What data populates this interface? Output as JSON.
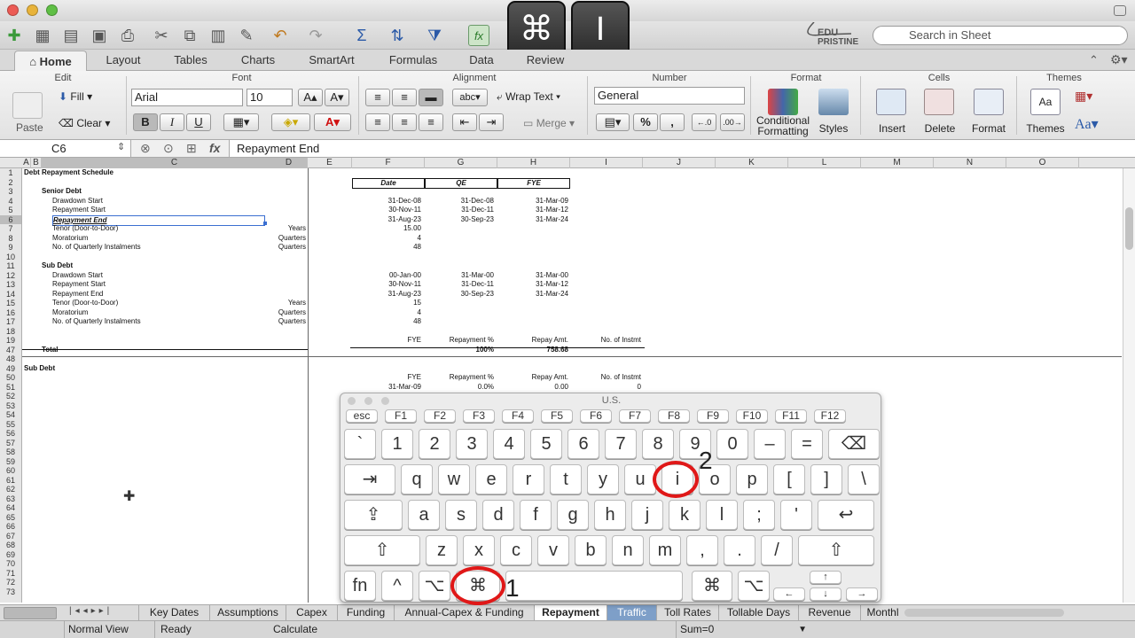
{
  "toolbar": {
    "search_placeholder": "Search in Sheet"
  },
  "ribbon_tabs": [
    "Home",
    "Layout",
    "Tables",
    "Charts",
    "SmartArt",
    "Formulas",
    "Data",
    "Review"
  ],
  "ribbon": {
    "groups": {
      "edit": "Edit",
      "font": "Font",
      "alignment": "Alignment",
      "number": "Number",
      "format": "Format",
      "cells": "Cells",
      "themes": "Themes"
    },
    "paste": "Paste",
    "fill": "Fill",
    "clear": "Clear",
    "font_name": "Arial",
    "font_size": "10",
    "wrap_text": "Wrap Text",
    "merge": "Merge",
    "abc": "abc",
    "number_format": "General",
    "conditional_formatting": "Conditional Formatting",
    "styles": "Styles",
    "insert": "Insert",
    "delete": "Delete",
    "format_btn": "Format",
    "themes_btn": "Themes",
    "bold": "B",
    "italic": "I",
    "underline": "U",
    "percent": "%",
    "comma": ","
  },
  "formula_bar": {
    "cell_ref": "C6",
    "content": "Repayment End",
    "fx": "fx"
  },
  "columns": [
    "A",
    "B",
    "C",
    "D",
    "E",
    "F",
    "G",
    "H",
    "I",
    "J",
    "K",
    "L",
    "M",
    "N",
    "O"
  ],
  "rows": [
    "1",
    "2",
    "3",
    "4",
    "5",
    "6",
    "7",
    "8",
    "9",
    "10",
    "11",
    "12",
    "13",
    "14",
    "15",
    "16",
    "17",
    "18",
    "19",
    "47",
    "48",
    "49",
    "50",
    "51",
    "52",
    "53",
    "54",
    "55",
    "56",
    "57",
    "58",
    "59",
    "60",
    "61",
    "62",
    "63",
    "64",
    "65",
    "66",
    "67",
    "68",
    "69",
    "70",
    "71",
    "72",
    "73"
  ],
  "sheet": {
    "title": "Debt Repayment Schedule",
    "hdr_date": "Date",
    "hdr_qe": "QE",
    "hdr_fye": "FYE",
    "senior_debt": "Senior Debt",
    "s_rows": [
      {
        "label": "Drawdown Start",
        "unit": "",
        "f": "31-Dec-08",
        "g": "31-Dec-08",
        "h": "31-Mar-09"
      },
      {
        "label": "Repayment Start",
        "unit": "",
        "f": "30-Nov-11",
        "g": "31-Dec-11",
        "h": "31-Mar-12"
      },
      {
        "label": "Repayment End",
        "unit": "",
        "f": "31-Aug-23",
        "g": "30-Sep-23",
        "h": "31-Mar-24"
      },
      {
        "label": "Tenor (Door-to-Door)",
        "unit": "Years",
        "f": "15.00",
        "g": "",
        "h": ""
      },
      {
        "label": "Moratorium",
        "unit": "Quarters",
        "f": "4",
        "g": "",
        "h": ""
      },
      {
        "label": "No. of Quarterly Instalments",
        "unit": "Quarters",
        "f": "48",
        "g": "",
        "h": ""
      }
    ],
    "sub_debt": "Sub Debt",
    "b_rows": [
      {
        "label": "Drawdown Start",
        "unit": "",
        "f": "00-Jan-00",
        "g": "31-Mar-00",
        "h": "31-Mar-00"
      },
      {
        "label": "Repayment Start",
        "unit": "",
        "f": "30-Nov-11",
        "g": "31-Dec-11",
        "h": "31-Mar-12"
      },
      {
        "label": "Repayment End",
        "unit": "",
        "f": "31-Aug-23",
        "g": "30-Sep-23",
        "h": "31-Mar-24"
      },
      {
        "label": "Tenor (Door-to-Door)",
        "unit": "Years",
        "f": "15",
        "g": "",
        "h": ""
      },
      {
        "label": "Moratorium",
        "unit": "Quarters",
        "f": "4",
        "g": "",
        "h": ""
      },
      {
        "label": "No. of Quarterly Instalments",
        "unit": "Quarters",
        "f": "48",
        "g": "",
        "h": ""
      }
    ],
    "r19": {
      "f": "FYE",
      "g": "Repayment %",
      "h": "Repay Amt.",
      "i": "No. of Instmt"
    },
    "total": "Total",
    "total_g": "100%",
    "total_h": "758.68",
    "sub_debt_2": "Sub Debt",
    "r50": {
      "f": "FYE",
      "g": "Repayment %",
      "h": "Repay Amt.",
      "i": "No. of Instmt"
    },
    "r51": {
      "f": "31-Mar-09",
      "g": "0.0%",
      "h": "0.00",
      "i": "0"
    }
  },
  "sheet_tabs": [
    "Key Dates",
    "Assumptions",
    "Capex",
    "Funding",
    "Annual-Capex & Funding",
    "Repayment",
    "Traffic",
    "Toll Rates",
    "Tollable Days",
    "Revenue",
    "Monthl"
  ],
  "active_sheet": "Repayment",
  "status": {
    "view": "Normal View",
    "state": "Ready",
    "calc": "Calculate",
    "sum": "Sum=0"
  },
  "logo": {
    "line1": "EDU",
    "line2": "PRISTINE"
  },
  "overlay_keys": {
    "k1": "⌘",
    "k2": "I",
    "n1": "1",
    "n2": "2"
  },
  "keyboard": {
    "title": "U.S.",
    "fn_row": [
      "esc",
      "F1",
      "F2",
      "F3",
      "F4",
      "F5",
      "F6",
      "F7",
      "F8",
      "F9",
      "F10",
      "F11",
      "F12"
    ],
    "row1": [
      "`",
      "1",
      "2",
      "3",
      "4",
      "5",
      "6",
      "7",
      "8",
      "9",
      "0",
      "–",
      "=",
      "⌫"
    ],
    "row2": [
      "⇥",
      "q",
      "w",
      "e",
      "r",
      "t",
      "y",
      "u",
      "i",
      "o",
      "p",
      "[",
      "]",
      "\\"
    ],
    "row3": [
      "⇪",
      "a",
      "s",
      "d",
      "f",
      "g",
      "h",
      "j",
      "k",
      "l",
      ";",
      "'",
      "↩"
    ],
    "row4": [
      "⇧",
      "z",
      "x",
      "c",
      "v",
      "b",
      "n",
      "m",
      ",",
      ".",
      "/",
      "⇧"
    ],
    "row5": [
      "fn",
      "^",
      "⌥",
      "⌘",
      "⌘",
      "⌥"
    ],
    "arrows": [
      "↑",
      "←",
      "↓",
      "→"
    ],
    "mark1": "1",
    "mark2": "2"
  },
  "colors": {
    "accent": "#e01818"
  }
}
